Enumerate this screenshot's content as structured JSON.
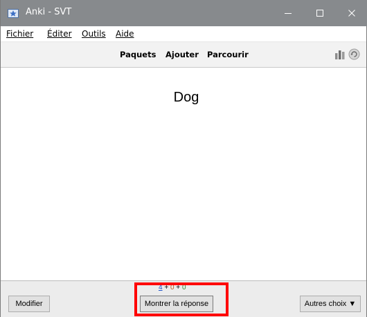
{
  "window": {
    "title": "Anki - SVT",
    "icon": "anki-star-icon"
  },
  "menu": {
    "items": [
      {
        "label": "Fichier"
      },
      {
        "label": "Éditer"
      },
      {
        "label": "Outils"
      },
      {
        "label": "Aide"
      }
    ]
  },
  "toolbar": {
    "links": [
      {
        "label": "Paquets"
      },
      {
        "label": "Ajouter"
      },
      {
        "label": "Parcourir"
      }
    ],
    "icons": [
      "stats-icon",
      "sync-icon"
    ]
  },
  "card": {
    "question": "Dog"
  },
  "bottom": {
    "counts": {
      "new": "4",
      "learn": "0",
      "review": "0",
      "separator": " + "
    },
    "edit_button": "Modifier",
    "show_answer_button": "Montrer la réponse",
    "more_button": "Autres choix",
    "more_arrow": "▼"
  },
  "colors": {
    "titlebar": "#878a8d",
    "highlight": "#ff0000",
    "new_count": "#1f53c9",
    "learn_count": "#c35617",
    "review_count": "#2e8b2e"
  }
}
